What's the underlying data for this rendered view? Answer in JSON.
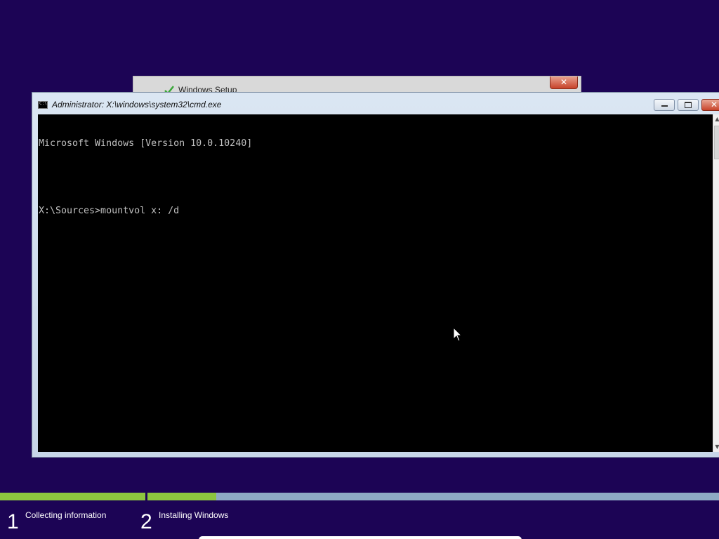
{
  "setup_window": {
    "title": "Windows Setup",
    "close_glyph": "✕"
  },
  "cmd_window": {
    "title": "Administrator: X:\\windows\\system32\\cmd.exe",
    "close_glyph": "✕",
    "console_lines": [
      "Microsoft Windows [Version 10.0.10240]",
      "",
      "X:\\Sources>mountvol x: /d"
    ],
    "scroll_up_glyph": "▲",
    "scroll_down_glyph": "▼"
  },
  "progress": {
    "step1_fraction": 1.0,
    "step2_fraction": 0.12,
    "color_filled": "#8cc63f",
    "color_empty": "#8eaac4"
  },
  "steps": [
    {
      "number": "1",
      "label": "Collecting information"
    },
    {
      "number": "2",
      "label": "Installing Windows"
    }
  ],
  "colors": {
    "background": "#1c0455",
    "console_bg": "#000000",
    "console_text": "#c0c0c0"
  },
  "icons": {
    "setup": "windows-setup-icon",
    "cmd": "cmd-icon",
    "cursor": "mouse-cursor-icon"
  }
}
